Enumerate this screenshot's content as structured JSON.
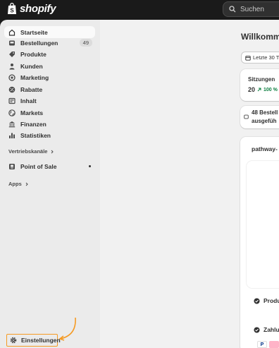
{
  "app": {
    "brand": "shopify"
  },
  "search": {
    "placeholder": "Suchen"
  },
  "sidebar": {
    "items": [
      {
        "label": "Startseite",
        "icon": "home-icon",
        "active": true
      },
      {
        "label": "Bestellungen",
        "icon": "inbox-icon",
        "badge": "49"
      },
      {
        "label": "Produkte",
        "icon": "tag-icon"
      },
      {
        "label": "Kunden",
        "icon": "person-icon"
      },
      {
        "label": "Marketing",
        "icon": "target-icon"
      },
      {
        "label": "Rabatte",
        "icon": "discount-icon"
      },
      {
        "label": "Inhalt",
        "icon": "content-icon"
      },
      {
        "label": "Markets",
        "icon": "globe-icon"
      },
      {
        "label": "Finanzen",
        "icon": "bank-icon"
      },
      {
        "label": "Statistiken",
        "icon": "bar-chart-icon"
      }
    ],
    "sales_channels_label": "Vertriebskanäle",
    "pos_label": "Point of Sale",
    "apps_label": "Apps",
    "settings_label": "Einstellungen"
  },
  "main": {
    "welcome": "Willkomme",
    "date_range": "Letzte 30 T",
    "sessions": {
      "label": "Sitzungen",
      "value": "20",
      "change": "100 %"
    },
    "orders_notice": {
      "line1": "48 Bestell",
      "line2": "ausgefüh"
    },
    "store_name": "pathway-",
    "task_produ": "Produ",
    "task_zahlu": "Zahlu"
  },
  "colors": {
    "accent_orange": "#f59a23",
    "positive_green": "#0a7d3e"
  }
}
